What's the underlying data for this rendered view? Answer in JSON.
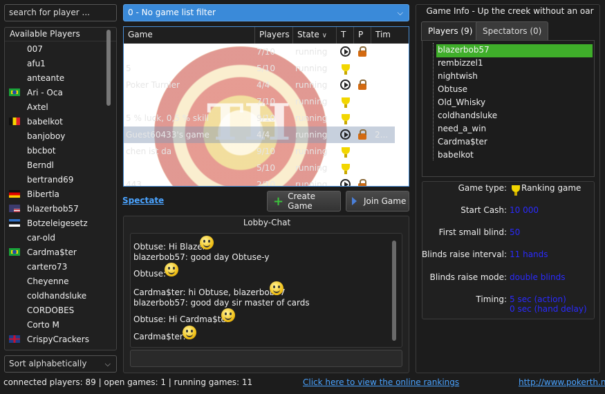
{
  "search": {
    "placeholder": "search for player ..."
  },
  "players_panel": {
    "header": "Available Players",
    "items": [
      {
        "name": "007",
        "flag": ""
      },
      {
        "name": "afu1",
        "flag": ""
      },
      {
        "name": "anteante",
        "flag": ""
      },
      {
        "name": "Ari - Oca",
        "flag": "brazil"
      },
      {
        "name": "Axtel",
        "flag": ""
      },
      {
        "name": "babelkot",
        "flag": "belgium"
      },
      {
        "name": "banjoboy",
        "flag": ""
      },
      {
        "name": "bbcbot",
        "flag": ""
      },
      {
        "name": "Berndl",
        "flag": ""
      },
      {
        "name": "bertrand69",
        "flag": ""
      },
      {
        "name": "Bibertla",
        "flag": "germany"
      },
      {
        "name": "blazerbob57",
        "flag": "usa"
      },
      {
        "name": "Botzeleigesetz",
        "flag": "estonia"
      },
      {
        "name": "car-old",
        "flag": ""
      },
      {
        "name": "Cardma$ter",
        "flag": "brazil"
      },
      {
        "name": "cartero73",
        "flag": ""
      },
      {
        "name": "Cheyenne",
        "flag": ""
      },
      {
        "name": "coldhandsluke",
        "flag": ""
      },
      {
        "name": "CORDOBES",
        "flag": ""
      },
      {
        "name": "Corto M",
        "flag": ""
      },
      {
        "name": "CrispyCrackers",
        "flag": "uk"
      }
    ]
  },
  "sort": {
    "selected": "Sort alphabetically"
  },
  "filter": {
    "selected": "0 - No game list filter"
  },
  "games": {
    "columns": [
      "Game",
      "Players",
      "State",
      "T",
      "P",
      "Tim"
    ],
    "rows": [
      {
        "game": "",
        "players": "7/10",
        "state": "running",
        "type": "play",
        "private": true,
        "time": ""
      },
      {
        "game": "5",
        "players": "5/10",
        "state": "running",
        "type": "trophy",
        "private": false,
        "time": ""
      },
      {
        "game": "Poker Turnier",
        "players": "4/4",
        "state": "running",
        "type": "play",
        "private": true,
        "time": ""
      },
      {
        "game": "",
        "players": "7/10",
        "state": "running",
        "type": "trophy",
        "private": false,
        "time": ""
      },
      {
        "game": "5 % luck, 0,5 % skill",
        "players": "9/10",
        "state": "running",
        "type": "trophy",
        "private": false,
        "time": ""
      },
      {
        "game": "Guest60433's game",
        "players": "4/4",
        "state": "running",
        "type": "play",
        "private": true,
        "time": "2..."
      },
      {
        "game": "chen ist da",
        "players": "9/10",
        "state": "running",
        "type": "trophy",
        "private": false,
        "time": ""
      },
      {
        "game": "",
        "players": "5/10",
        "state": "running",
        "type": "trophy",
        "private": false,
        "time": ""
      },
      {
        "game": "443",
        "players": "2/10",
        "state": "running",
        "type": "play",
        "private": true,
        "time": ""
      }
    ],
    "watermark_text": "TH"
  },
  "actions": {
    "spectate": "Spectate",
    "create_game": "Create Game",
    "join_game": "Join Game"
  },
  "chat": {
    "title": "Lobby-Chat",
    "lines": [
      {
        "text": "Obtuse: Hi Blazer",
        "smiley": true
      },
      {
        "text": "blazerbob57: good day Obtuse-y",
        "smiley": false
      },
      {
        "text": "Obtuse:",
        "smiley": true
      },
      {
        "text": "Cardma$ter: hi Obtuse, blazerbob57",
        "smiley": true
      },
      {
        "text": "blazerbob57: good day sir master of cards",
        "smiley": false
      },
      {
        "text": "Obtuse: Hi Cardma$ter",
        "smiley": true
      },
      {
        "text": "Cardma$ter:",
        "smiley": true
      }
    ]
  },
  "game_info": {
    "title": "Game Info - Up the creek without an oar",
    "tabs": [
      "Players (9)",
      "Spectators (0)"
    ],
    "players": [
      "blazerbob57",
      "rembizzel1",
      "nightwish",
      "Obtuse",
      "Old_Whisky",
      "coldhandsluke",
      "need_a_win",
      "Cardma$ter",
      "babelkot"
    ],
    "selected_player": "blazerbob57",
    "fields": {
      "game_type_label": "Game type:",
      "game_type_value": "Ranking game",
      "start_cash_label": "Start Cash:",
      "start_cash_value": "10 000",
      "first_blind_label": "First small blind:",
      "first_blind_value": "50",
      "raise_interval_label": "Blinds raise interval:",
      "raise_interval_value": "11 hands",
      "raise_mode_label": "Blinds raise mode:",
      "raise_mode_value": "double blinds",
      "timing_label": "Timing:",
      "timing_value_1": "5 sec (action)",
      "timing_value_2": "0 sec (hand delay)"
    }
  },
  "status": {
    "text": "connected players: 89 | open games: 1 | running games: 11",
    "rankings_link": "Click here to view the online rankings",
    "website_link": "http://www.pokerth.net"
  },
  "colors": {
    "accent": "#3a8ad9",
    "selection": "#3fae2a",
    "link": "#4aa3ff",
    "value": "#2a2aff"
  }
}
